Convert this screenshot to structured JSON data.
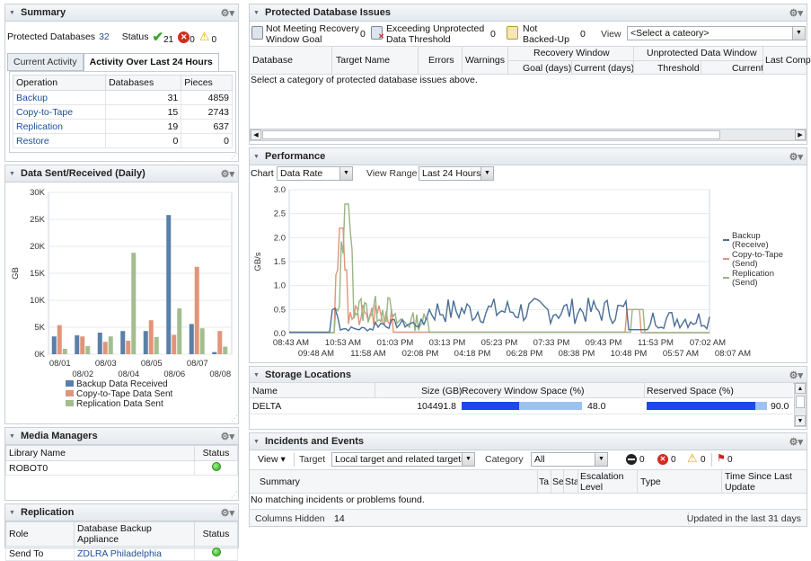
{
  "summary": {
    "title": "Summary",
    "protected_label": "Protected Databases",
    "protected_count": "32",
    "status_label": "Status",
    "ok_count": "21",
    "error_count": "0",
    "warn_count": "0",
    "tabs": [
      "Current Activity",
      "Activity Over Last 24 Hours"
    ],
    "headers": [
      "Operation",
      "Databases",
      "Pieces"
    ],
    "rows": [
      [
        "Backup",
        "31",
        "4859"
      ],
      [
        "Copy-to-Tape",
        "15",
        "2743"
      ],
      [
        "Replication",
        "19",
        "637"
      ],
      [
        "Restore",
        "0",
        "0"
      ]
    ]
  },
  "data_sent": {
    "title": "Data Sent/Received (Daily)",
    "chart_data": {
      "type": "bar",
      "ylabel": "GB",
      "ylim": [
        0,
        30000
      ],
      "yticks": [
        "0K",
        "5K",
        "10K",
        "15K",
        "20K",
        "25K",
        "30K"
      ],
      "categories": [
        "08/01",
        "08/02",
        "08/03",
        "08/04",
        "08/05",
        "08/06",
        "08/07",
        "08/08"
      ],
      "series": [
        {
          "name": "Backup Data Received",
          "color": "#5a7fa8",
          "values": [
            3300,
            3500,
            4000,
            4300,
            4300,
            25800,
            5600,
            400
          ]
        },
        {
          "name": "Copy-to-Tape Data Sent",
          "color": "#e0957a",
          "values": [
            5400,
            3300,
            2300,
            2500,
            6300,
            3600,
            16200,
            4300
          ]
        },
        {
          "name": "Replication Data Sent",
          "color": "#a3bd8f",
          "values": [
            1000,
            1500,
            3300,
            18800,
            3200,
            8500,
            4800,
            1400
          ]
        }
      ]
    }
  },
  "media": {
    "title": "Media Managers",
    "headers": [
      "Library Name",
      "Status"
    ],
    "rows": [
      [
        "ROBOT0",
        ""
      ]
    ]
  },
  "replication": {
    "title": "Replication",
    "headers": [
      "Role",
      "Database Backup Appliance",
      "Status"
    ],
    "rows": [
      [
        "Send To",
        "ZDLRA Philadelphia",
        ""
      ]
    ]
  },
  "issues": {
    "title": "Protected Database Issues",
    "filters": [
      {
        "label1": "Not Meeting Recovery",
        "label2": "Window Goal",
        "count": "0"
      },
      {
        "label1": "Exceeding Unprotected",
        "label2": "Data Threshold",
        "count": "0"
      },
      {
        "label1": "Not",
        "label2": "Backed-Up",
        "count": "0"
      }
    ],
    "view_label": "View",
    "view_value": "<Select a cateory>",
    "headers": {
      "database": "Database",
      "target": "Target Name",
      "errors": "Errors",
      "warnings": "Warnings",
      "rw": "Recovery Window",
      "goal": "Goal (days)",
      "current_days": "Current (days)",
      "udw": "Unprotected Data Window",
      "threshold": "Threshold",
      "current": "Current",
      "last": "Last Comp"
    },
    "message": "Select a category of protected database issues above."
  },
  "performance": {
    "title": "Performance",
    "chart_label": "Chart",
    "chart_value": "Data Rate",
    "range_label": "View Range",
    "range_value": "Last 24 Hours",
    "chart_data": {
      "type": "line",
      "ylabel": "GB/s",
      "ylim": [
        0,
        3.0
      ],
      "yticks": [
        "0.0",
        "0.5",
        "1.0",
        "1.5",
        "2.0",
        "2.5",
        "3.0"
      ],
      "xticks_top": [
        "08:43 AM",
        "10:53 AM",
        "01:03 PM",
        "03:13 PM",
        "05:23 PM",
        "07:33 PM",
        "09:43 PM",
        "11:53 PM",
        "07:02 AM"
      ],
      "xticks_bottom": [
        "09:48 AM",
        "11:58 AM",
        "02:08 PM",
        "04:18 PM",
        "06:28 PM",
        "08:38 PM",
        "10:48 PM",
        "05:57 AM",
        "08:07 AM"
      ],
      "series": [
        {
          "name": "Backup (Receive)",
          "color": "#4a6f96"
        },
        {
          "name": "Copy-to-Tape (Send)",
          "color": "#e0957a"
        },
        {
          "name": "Replication (Send)",
          "color": "#98b585"
        }
      ]
    }
  },
  "storage": {
    "title": "Storage Locations",
    "headers": [
      "Name",
      "Size (GB)",
      "Recovery Window Space (%)",
      "Reserved Space (%)"
    ],
    "rows": [
      {
        "name": "DELTA",
        "size": "104491.8",
        "rw": "48.0",
        "rw_pct": 48,
        "reserved": "90.0",
        "reserved_pct": 90
      }
    ]
  },
  "incidents": {
    "title": "Incidents and Events",
    "view_label": "View",
    "target_label": "Target",
    "target_value": "Local target and related targets",
    "category_label": "Category",
    "category_value": "All",
    "counts": [
      "0",
      "0",
      "0",
      "0"
    ],
    "headers": [
      "Summary",
      "Ta",
      "Se",
      "Sta",
      "Escalation Level",
      "Type",
      "Time Since Last Update"
    ],
    "message": "No matching incidents or problems found.",
    "columns_hidden_label": "Columns Hidden",
    "columns_hidden": "14",
    "updated": "Updated in the last 31 days"
  }
}
